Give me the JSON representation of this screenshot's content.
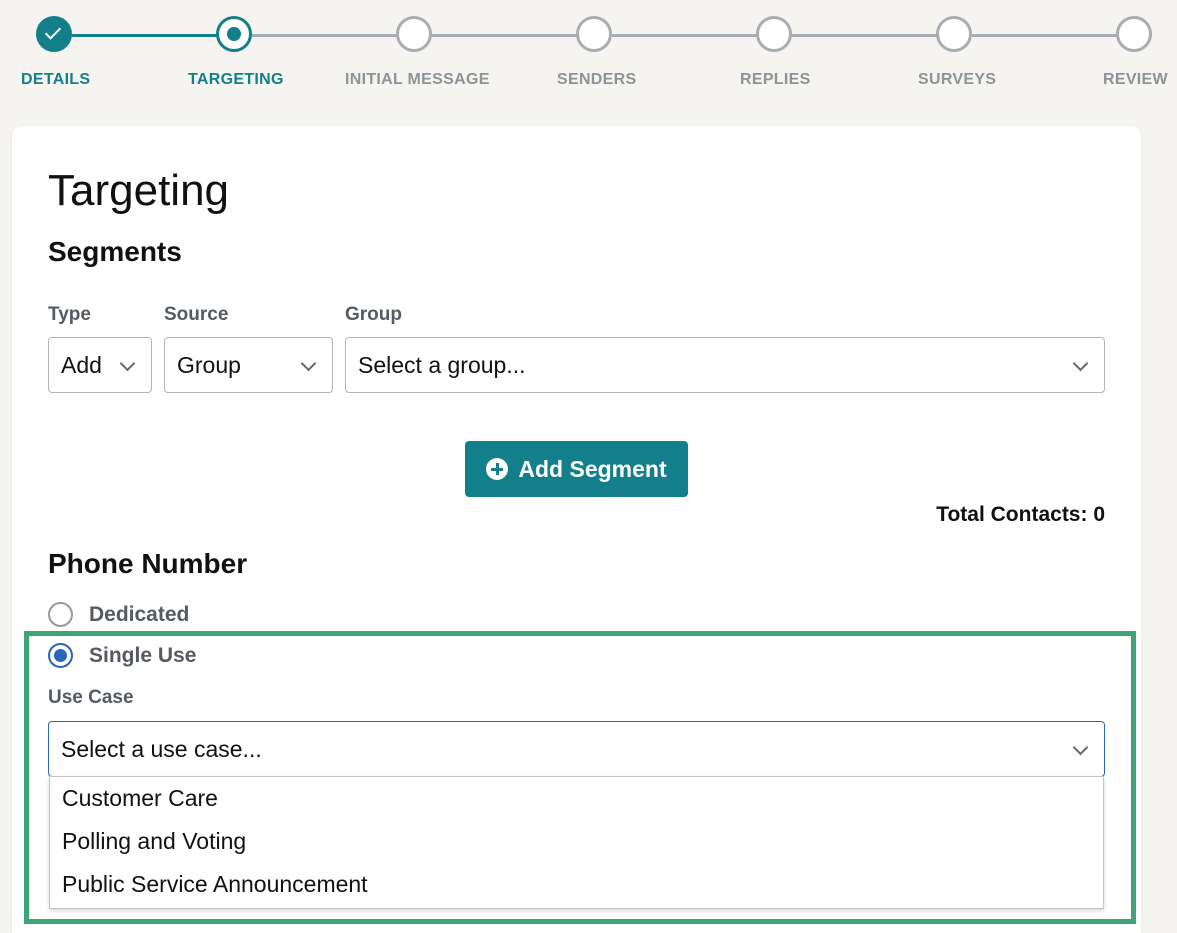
{
  "stepper": {
    "steps": [
      {
        "label": "DETAILS",
        "state": "complete"
      },
      {
        "label": "TARGETING",
        "state": "current"
      },
      {
        "label": "INITIAL MESSAGE",
        "state": "pending"
      },
      {
        "label": "SENDERS",
        "state": "pending"
      },
      {
        "label": "REPLIES",
        "state": "pending"
      },
      {
        "label": "SURVEYS",
        "state": "pending"
      },
      {
        "label": "REVIEW",
        "state": "pending"
      }
    ]
  },
  "page": {
    "title": "Targeting"
  },
  "segments": {
    "title": "Segments",
    "type_label": "Type",
    "type_value": "Add",
    "source_label": "Source",
    "source_value": "Group",
    "group_label": "Group",
    "group_placeholder": "Select a group...",
    "add_button": "Add Segment",
    "total_contacts": "Total Contacts: 0"
  },
  "phone_number": {
    "title": "Phone Number",
    "options": [
      {
        "label": "Dedicated",
        "checked": false
      },
      {
        "label": "Single Use",
        "checked": true
      }
    ],
    "use_case_label": "Use Case",
    "use_case_placeholder": "Select a use case...",
    "use_case_options": [
      "Customer Care",
      "Polling and Voting",
      "Public Service Announcement"
    ]
  },
  "colors": {
    "accent": "#137f8a",
    "highlight": "#3fa478",
    "radio_selected": "#2866b8"
  },
  "icons": {
    "check": "check-icon",
    "chevron": "chevron-down-icon",
    "plus": "plus-circle-icon"
  }
}
